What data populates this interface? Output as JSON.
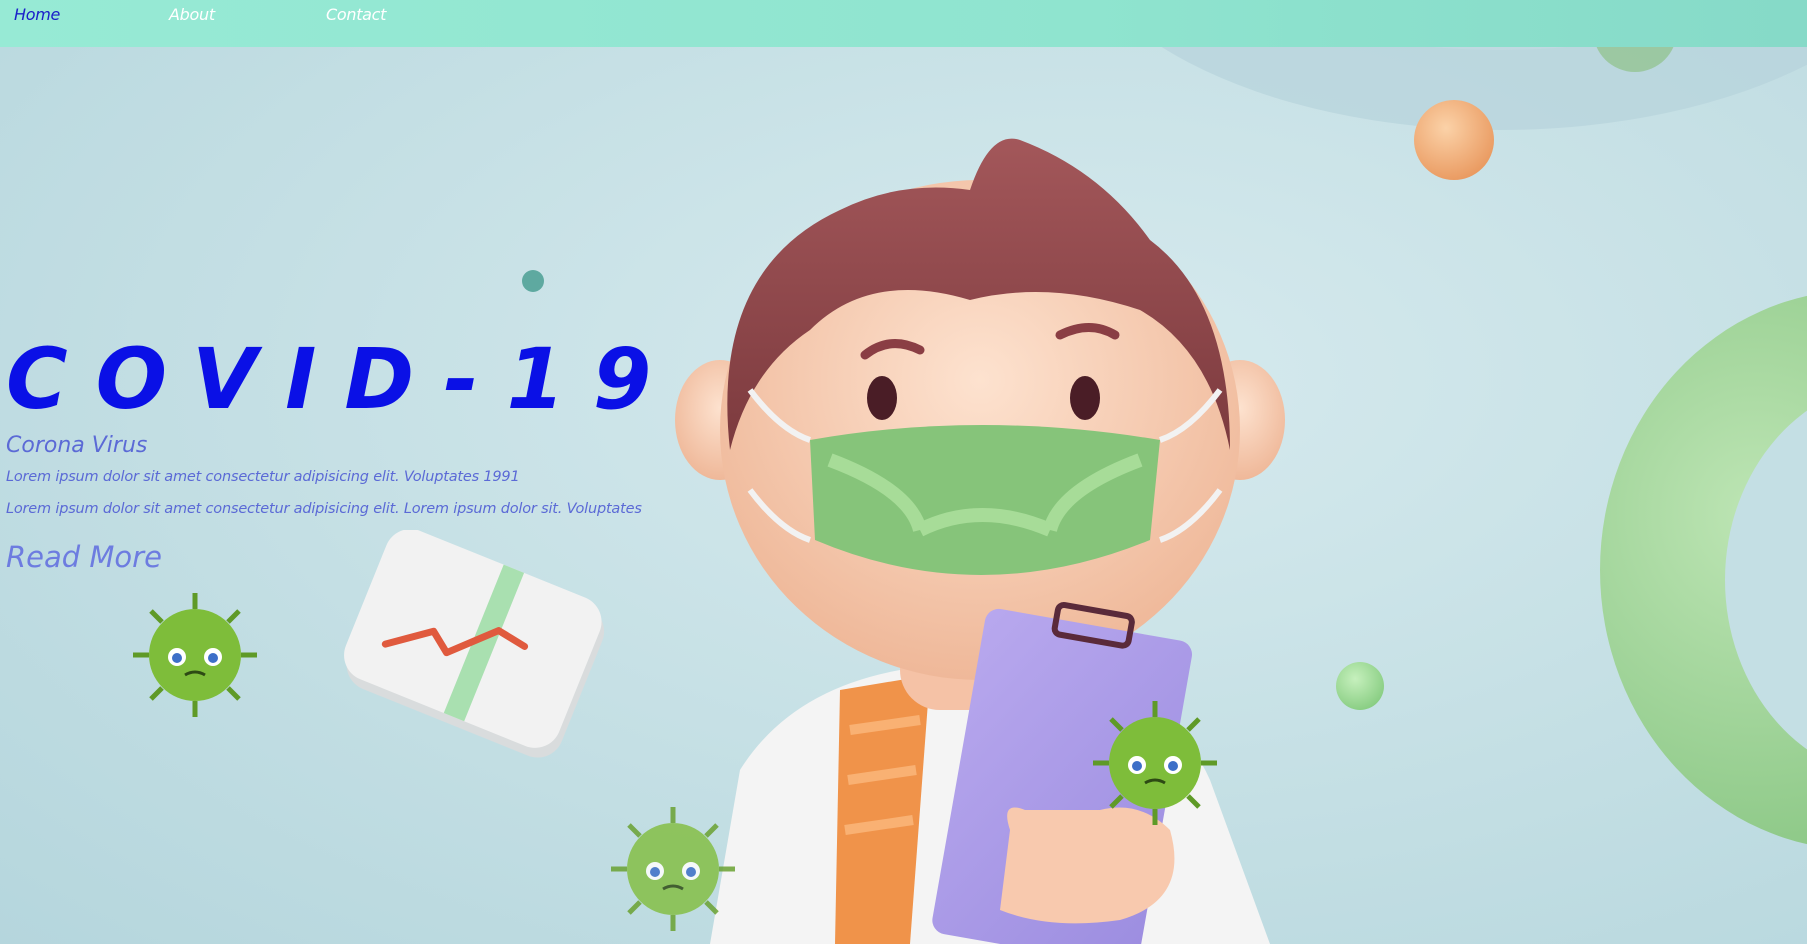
{
  "nav": {
    "items": [
      {
        "label": "Home",
        "active": true
      },
      {
        "label": "About",
        "active": false
      },
      {
        "label": "Contact",
        "active": false
      }
    ]
  },
  "hero": {
    "title": "COVID-19",
    "subtitle": "Corona Virus",
    "line1": "Lorem ipsum dolor sit amet consectetur adipisicing elit. Voluptates 1991",
    "line2": "Lorem ipsum dolor sit amet consectetur adipisicing elit. Lorem ipsum dolor sit. Voluptates",
    "cta": "Read More"
  },
  "colors": {
    "navbar": "#97ead5",
    "active_link": "#1a20c9",
    "title": "#0a10e6",
    "text": "#5b6ad6",
    "cta": "#6d7ce0"
  },
  "icons": [
    "virus-icon",
    "chart-card-icon",
    "doctor-character-illustration"
  ]
}
